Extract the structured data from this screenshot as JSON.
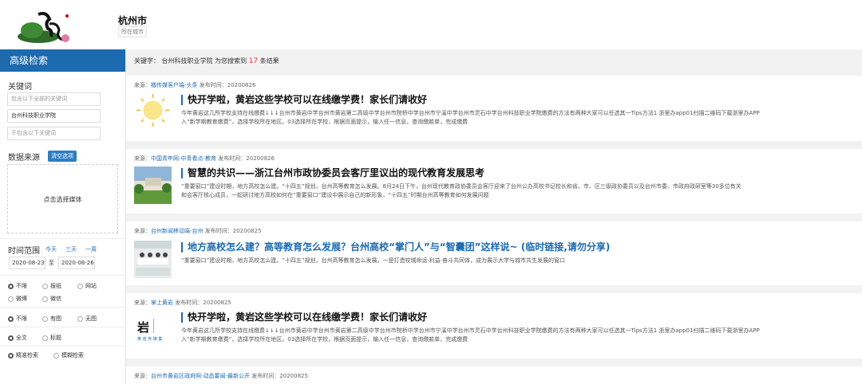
{
  "header": {
    "city": "杭州市",
    "city_tag": "所在城市"
  },
  "sidebar": {
    "title": "高级检索",
    "keyword_label": "关键词",
    "kw_all_placeholder": "包含以下全部的关键词",
    "kw_value": "台州科技职业学院",
    "kw_none_placeholder": "不包含以下关键词",
    "source_label": "数据来源",
    "clear_btn": "清空选项",
    "media_btn": "点击选择媒体",
    "time_label": "时间范围",
    "time_links": [
      "今天",
      "三天",
      "一周"
    ],
    "date_from": "2020-08-23",
    "date_sep": "至",
    "date_to": "2020-08-26",
    "type_options": [
      "不限",
      "报纸",
      "网站",
      "微博",
      "微信"
    ],
    "image_options": [
      "不限",
      "有图",
      "无图"
    ],
    "scope_options": [
      "全文",
      "标题"
    ],
    "match_options": [
      "精准检索",
      "模糊检索"
    ]
  },
  "summary": {
    "prefix": "关键字：",
    "keyword": "台州科技职业学院",
    "mid": "为您搜索到",
    "count": "17",
    "suffix": "条结果"
  },
  "results": [
    {
      "src_label": "来源：",
      "src_name": "橘传媒客户端-头条",
      "date": "发布时间：20200826",
      "title": "快开学啦，黄岩这些学校可以在线缴学费！家长们请收好",
      "line1": "今年黄岩这几所学校支持在线缴费↓↓↓台州市黄岩中学台州市黄岩第二高级中学台州市院桥中学台州市宁溪中学台州市灵石中学台州科技职业学院缴费的方法有两种大家可以任选其一Tips方法1 浙里办app01扫描二维码下载浙里办APP",
      "line2": "入“新学期教育缴费”，选择学校所在地区。03选择所在学校，根据页面提示，输入任一信息，查询缴款单，完成缴费"
    },
    {
      "src_label": "来源：",
      "src_name": "中国青年网-中青看点-教育",
      "date": "发布时间：20200826",
      "title": "智慧的共识——浙江台州市政协委员会客厅里议出的现代教育发展思考",
      "line1": "“重要窗口”建设时期，地方高校怎么建。“十四五”规划，台州高等教育怎么发展。8月24日下午，台州现代教育政协委员会客厅迎来了台州公办高校书记校长和省、市、区三级政协委员以及台州市委、市政府政研室等30多位有关",
      "line2": "和会客厅核心成员，一起研讨地方高校如何在“重要窗口”建设中展示自己的新形象，“十四五”时期台州高等教育如何发展问题"
    },
    {
      "src_label": "来源：",
      "src_name": "台州新闻移动端-台州",
      "date": "发布时间：20200825",
      "title": "地方高校怎么建？高等教育怎么发展？台州高校“掌门人”与“智囊团”这样说~ (临时链接,请勿分享)",
      "line1": "“重要窗口”建设时期，地方高校怎么建。“十四五”规划，台州高等教育怎么发展。一是打造校城命运·利益·奋斗共同体，成为展示大学与城市共生发展的窗口",
      "line2": ""
    },
    {
      "src_label": "来源：",
      "src_name": "掌上黄岩",
      "date": "发布时间：20200825",
      "title": "快开学啦，黄岩这些学校可以在线缴学费！家长们请收好",
      "line1": "今年黄岩这几所学校支持在线缴费↓↓↓台州市黄岩中学台州市黄岩第二高级中学台州市院桥中学台州市宁溪中学台州市灵石中学台州科技职业学院缴费的方法有两种大家可以任选其一Tips方法1 浙里办app01扫描二维码下载浙里办APP",
      "line2": "入“新学期教育缴费”，选择学校所在地区。03选择所在学校，根据页面提示，输入任一信息，查询缴款单，完成缴费",
      "thumb_glyph": "岩",
      "thumb_caption": "黄 岩 传 媒 集"
    },
    {
      "src_label": "来源：",
      "src_name": "台州市黄岩区政府网-动态要闻-最新公开",
      "date": "发布时间：20200825"
    }
  ]
}
